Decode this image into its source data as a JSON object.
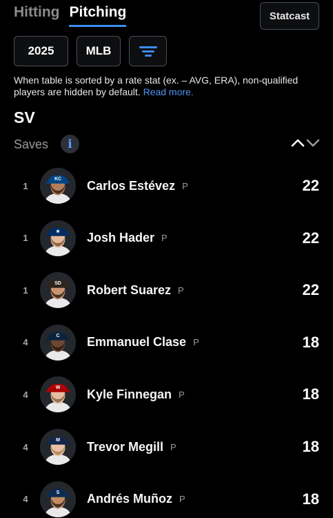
{
  "tabs": [
    {
      "label": "Hitting",
      "active": false
    },
    {
      "label": "Pitching",
      "active": true
    }
  ],
  "statcast_label": "Statcast",
  "filters": {
    "season": "2025",
    "league": "MLB",
    "sort_icon": "sort-filter-icon"
  },
  "note": {
    "text": "When table is sorted by a rate stat (ex. – AVG, ERA), non-qualified players are hidden by default.",
    "link": "Read more."
  },
  "stat": {
    "abbr": "SV",
    "name": "Saves",
    "info_icon": "i"
  },
  "colors": {
    "accent": "#3b8df0",
    "background": "#000000"
  },
  "players": [
    {
      "rank": "1",
      "name": "Carlos Estévez",
      "pos": "P",
      "value": "22",
      "cap": "#004687",
      "logo": "KC",
      "skin": "#b57e5a",
      "hair": "#2a1a12"
    },
    {
      "rank": "1",
      "name": "Josh Hader",
      "pos": "P",
      "value": "22",
      "cap": "#002d62",
      "logo": "★",
      "skin": "#e3b898",
      "hair": "#6b4a2b"
    },
    {
      "rank": "1",
      "name": "Robert Suarez",
      "pos": "P",
      "value": "22",
      "cap": "#2f241d",
      "logo": "SD",
      "skin": "#c9946e",
      "hair": "#1a1410"
    },
    {
      "rank": "4",
      "name": "Emmanuel Clase",
      "pos": "P",
      "value": "18",
      "cap": "#0c2340",
      "logo": "C",
      "skin": "#6e4631",
      "hair": "#1a1410"
    },
    {
      "rank": "4",
      "name": "Kyle Finnegan",
      "pos": "P",
      "value": "18",
      "cap": "#ab0003",
      "logo": "W",
      "skin": "#e6bba0",
      "hair": "#7a5634"
    },
    {
      "rank": "4",
      "name": "Trevor Megill",
      "pos": "P",
      "value": "18",
      "cap": "#12284b",
      "logo": "M",
      "skin": "#e8c0a2",
      "hair": "#a07b50"
    },
    {
      "rank": "4",
      "name": "Andrés Muñoz",
      "pos": "P",
      "value": "18",
      "cap": "#0c2c56",
      "logo": "S",
      "skin": "#c08a64",
      "hair": "#1a1410"
    }
  ]
}
